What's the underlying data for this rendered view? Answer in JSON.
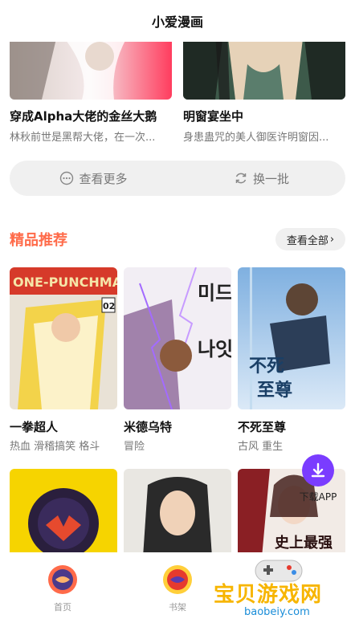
{
  "header": {
    "title": "小爱漫画"
  },
  "top_cards": [
    {
      "title": "穿成Alpha大佬的金丝大鹅",
      "desc": "林秋前世是黑帮大佬，在一次..."
    },
    {
      "title": "明窗宴坐中",
      "desc": "身患蛊咒的美人御医许明窗因..."
    }
  ],
  "actions": {
    "more": "查看更多",
    "refresh": "换一批"
  },
  "featured": {
    "title": "精品推荐",
    "view_all": "查看全部",
    "items": [
      {
        "title": "一拳超人",
        "tags": "热血 滑稽搞笑 格斗",
        "cover_text": "ONE-PUNCHMAN"
      },
      {
        "title": "米德乌特",
        "tags": "冒险",
        "cover_text": "미드 나잇"
      },
      {
        "title": "不死至尊",
        "tags": "古风 重生",
        "cover_text": "不死至尊"
      }
    ],
    "row2_cover_text": [
      "",
      "",
      "史上最强"
    ]
  },
  "float_download": {
    "label": "下载APP"
  },
  "tabbar": [
    {
      "label": "首页",
      "icon": "home-icon"
    },
    {
      "label": "书架",
      "icon": "bookshelf-icon"
    }
  ],
  "watermark": {
    "text": "宝贝游戏网",
    "url": "baobeiy.com"
  },
  "colors": {
    "accent": "#ff6b4a",
    "download": "#7a3cff",
    "watermark": "#f7b500"
  }
}
